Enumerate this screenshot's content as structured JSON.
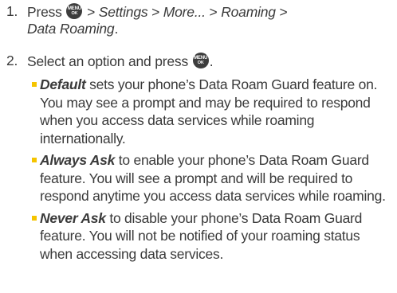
{
  "steps": [
    {
      "number": "1.",
      "text_before": "Press ",
      "separator": " > ",
      "path": [
        "Settings",
        "More...",
        "Roaming",
        "Data Roaming"
      ],
      "end": "."
    },
    {
      "number": "2.",
      "text_before": "Select an option and press ",
      "end": "."
    }
  ],
  "key_icon": {
    "top_label": "MENU",
    "bottom_label": "OK",
    "name": "menu-ok-key-icon",
    "color": "#3d3d3d"
  },
  "options": [
    {
      "term": "Default",
      "description": " sets your phone’s Data Roam Guard feature on. You may see a prompt and may be required to respond when you access data services while roaming internationally."
    },
    {
      "term": "Always Ask",
      "description": " to enable your phone’s Data Roam Guard feature. You will see a prompt and will be required to respond anytime you access data services while roaming."
    },
    {
      "term": "Never Ask",
      "description": " to disable your phone’s Data Roam Guard feature. You will not be notified of your roaming status when accessing data services."
    }
  ],
  "colors": {
    "text": "#3a3a3a",
    "bullet": "#f5c400"
  }
}
